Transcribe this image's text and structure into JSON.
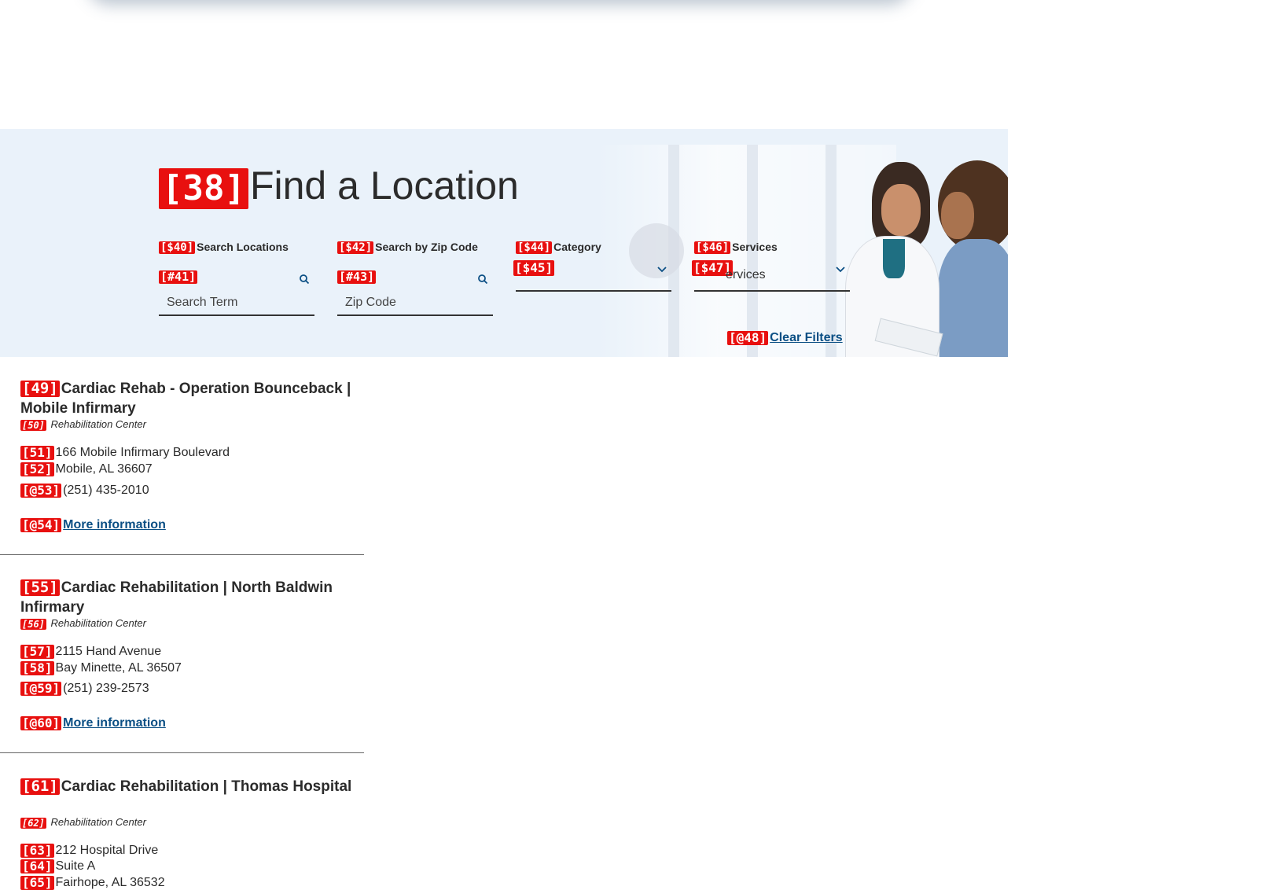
{
  "hero": {
    "title_tag": "[38]",
    "title": "Find a Location",
    "filters": {
      "search": {
        "label_tag": "[$40]",
        "label": "Search Locations",
        "input_tag": "[#41]",
        "placeholder": "Search Term"
      },
      "zip": {
        "label_tag": "[$42]",
        "label": "Search by Zip Code",
        "input_tag": "[#43]",
        "placeholder": "Zip Code"
      },
      "category": {
        "label_tag": "[$44]",
        "label": "Category",
        "select_tag": "[$45]",
        "value": ""
      },
      "services": {
        "label_tag": "[$46]",
        "label": "Services",
        "select_tag": "[$47]",
        "value": "ervices"
      }
    },
    "clear_filters": {
      "tag": "[@48]",
      "label": "Clear Filters"
    }
  },
  "results": [
    {
      "title_tag": "[49]",
      "title": "Cardiac Rehab - Operation Bounceback | Mobile Infirmary",
      "category_tag": "[50]",
      "category": "Rehabilitation Center",
      "address": [
        {
          "tag": "[51]",
          "text": "166 Mobile Infirmary Boulevard"
        },
        {
          "tag": "[52]",
          "text": "Mobile, AL 36607"
        }
      ],
      "phone_tag": "[@53]",
      "phone": "(251) 435-2010",
      "more_tag": "[@54]",
      "more": "More information"
    },
    {
      "title_tag": "[55]",
      "title": "Cardiac Rehabilitation | North Baldwin Infirmary",
      "category_tag": "[56]",
      "category": "Rehabilitation Center",
      "address": [
        {
          "tag": "[57]",
          "text": "2115 Hand Avenue"
        },
        {
          "tag": "[58]",
          "text": "Bay Minette, AL 36507"
        }
      ],
      "phone_tag": "[@59]",
      "phone": "(251) 239-2573",
      "more_tag": "[@60]",
      "more": "More information"
    },
    {
      "title_tag": "[61]",
      "title": "Cardiac Rehabilitation | Thomas Hospital",
      "category_tag": "[62]",
      "category": "Rehabilitation Center",
      "address": [
        {
          "tag": "[63]",
          "text": "212 Hospital Drive"
        },
        {
          "tag": "[64]",
          "text": "Suite A"
        },
        {
          "tag": "[65]",
          "text": "Fairhope, AL 36532"
        }
      ]
    }
  ],
  "colors": {
    "tag_bg": "#e8100f",
    "link": "#0b4f84",
    "hero_bg": "#eaf2fa",
    "text": "#2b2b2b"
  }
}
